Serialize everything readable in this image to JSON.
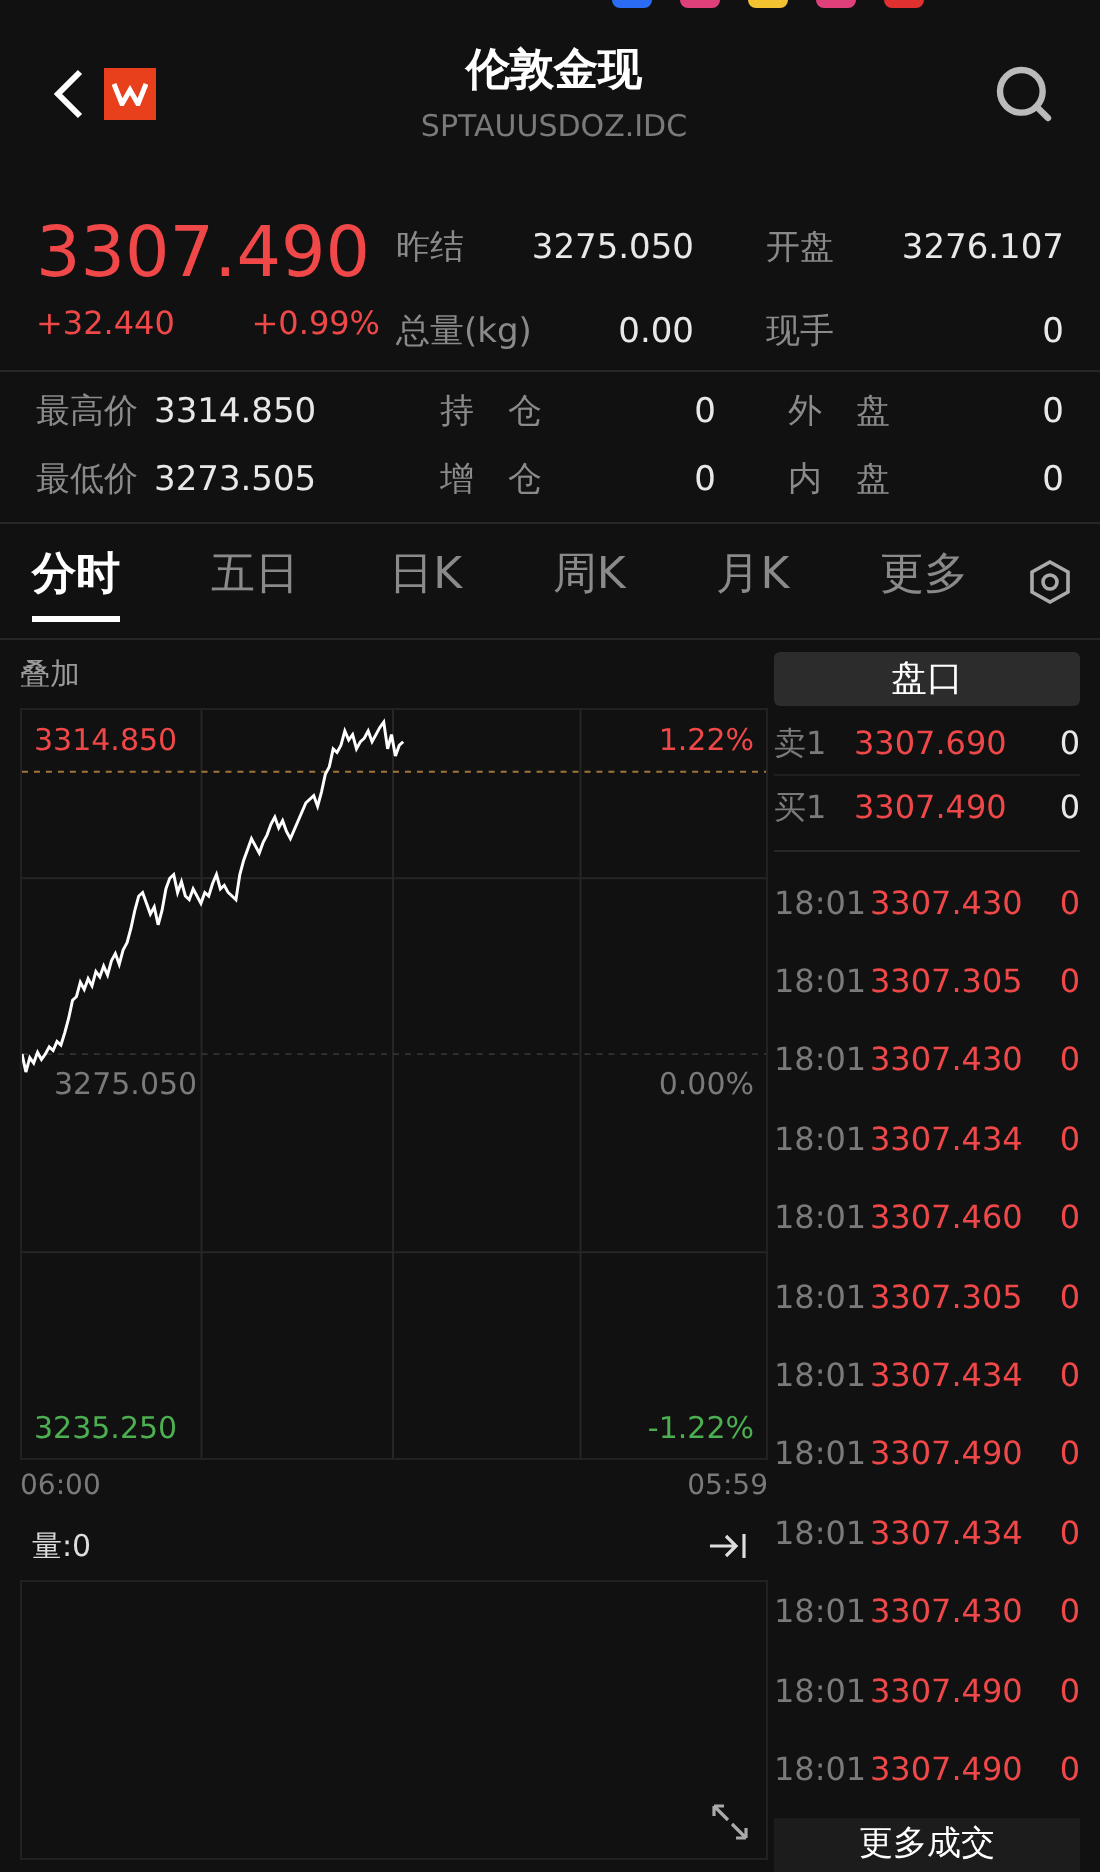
{
  "header": {
    "title": "伦敦金现",
    "code": "SPTAUUSDOZ.IDC"
  },
  "quote": {
    "price": "3307.490",
    "change": "+32.440",
    "change_pct": "+0.99%"
  },
  "stats_top": [
    {
      "label": "昨结",
      "value": "3275.050"
    },
    {
      "label": "开盘",
      "value": "3276.107"
    },
    {
      "label": "总量(kg)",
      "value": "0.00"
    },
    {
      "label": "现手",
      "value": "0"
    }
  ],
  "stats_bottom": [
    {
      "label": "最高价",
      "value": "3314.850"
    },
    {
      "label": "持　仓",
      "value": "0"
    },
    {
      "label": "外　盘",
      "value": "0"
    },
    {
      "label": "最低价",
      "value": "3273.505"
    },
    {
      "label": "增　仓",
      "value": "0"
    },
    {
      "label": "内　盘",
      "value": "0"
    }
  ],
  "tabs": [
    {
      "label": "分时",
      "selected": true
    },
    {
      "label": "五日",
      "selected": false
    },
    {
      "label": "日K",
      "selected": false
    },
    {
      "label": "周K",
      "selected": false
    },
    {
      "label": "月K",
      "selected": false
    },
    {
      "label": "更多",
      "selected": false
    }
  ],
  "chart": {
    "overlay": "叠加",
    "high_price": "3314.850",
    "high_pct": "1.22%",
    "base_price": "3275.050",
    "base_pct": "0.00%",
    "low_price": "3235.250",
    "low_pct": "-1.22%",
    "start_time": "06:00",
    "end_time": "05:59"
  },
  "volume": {
    "label": "量:0"
  },
  "orderbook": {
    "button": "盘口",
    "levels": [
      {
        "label": "卖1",
        "price": "3307.690",
        "volume": "0"
      },
      {
        "label": "买1",
        "price": "3307.490",
        "volume": "0"
      }
    ],
    "trades": [
      {
        "time": "18:01",
        "price": "3307.430",
        "volume": "0"
      },
      {
        "time": "18:01",
        "price": "3307.305",
        "volume": "0"
      },
      {
        "time": "18:01",
        "price": "3307.430",
        "volume": "0"
      },
      {
        "time": "18:01",
        "price": "3307.434",
        "volume": "0"
      },
      {
        "time": "18:01",
        "price": "3307.460",
        "volume": "0"
      },
      {
        "time": "18:01",
        "price": "3307.305",
        "volume": "0"
      },
      {
        "time": "18:01",
        "price": "3307.434",
        "volume": "0"
      },
      {
        "time": "18:01",
        "price": "3307.490",
        "volume": "0"
      },
      {
        "time": "18:01",
        "price": "3307.434",
        "volume": "0"
      },
      {
        "time": "18:01",
        "price": "3307.430",
        "volume": "0"
      },
      {
        "time": "18:01",
        "price": "3307.490",
        "volume": "0"
      },
      {
        "time": "18:01",
        "price": "3307.490",
        "volume": "0"
      }
    ],
    "more_button": "更多成交"
  }
}
